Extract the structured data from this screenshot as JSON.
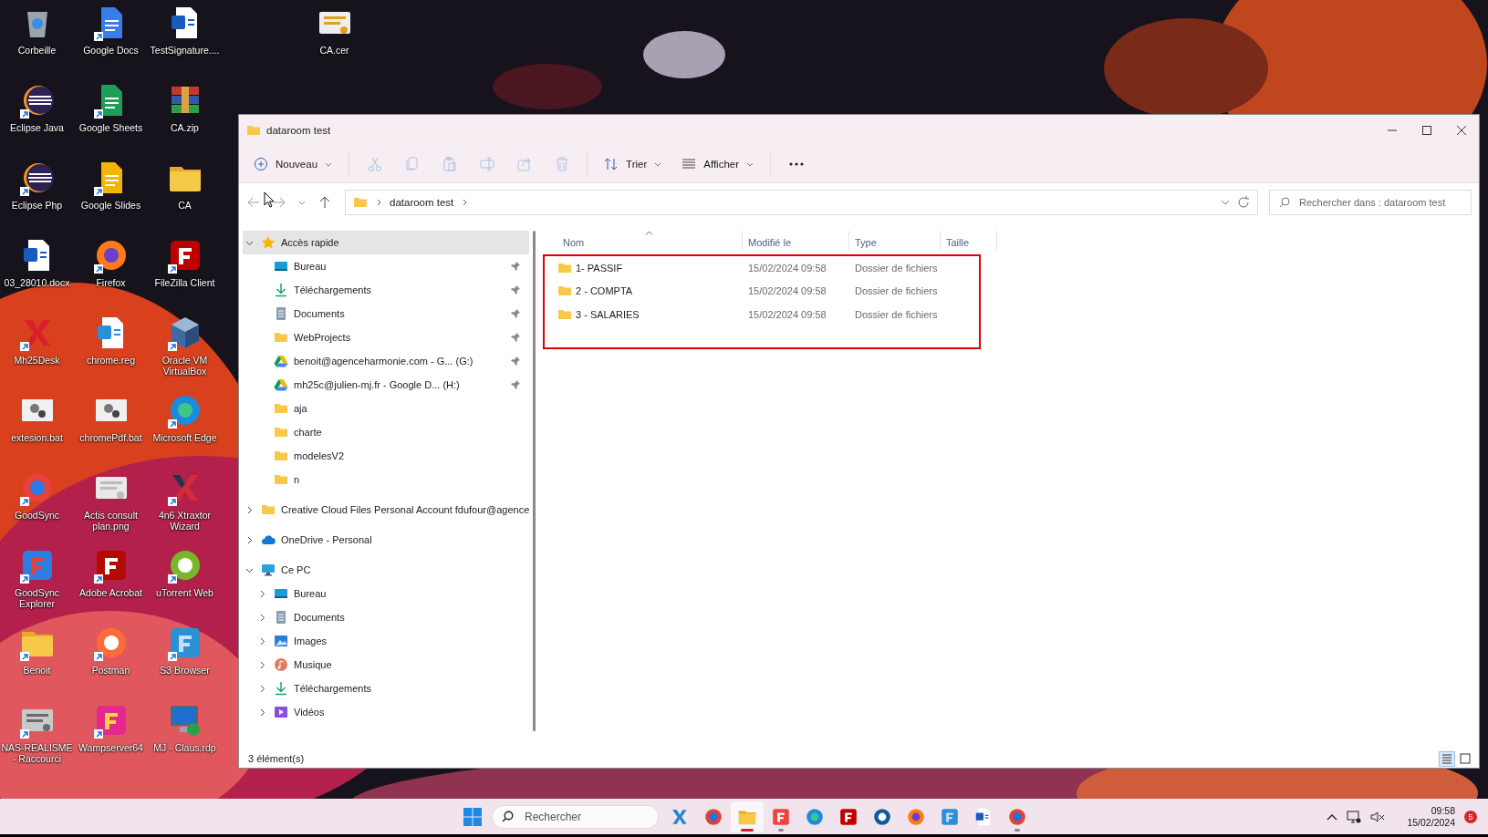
{
  "desktop": {
    "icons": [
      {
        "label": "Corbeille",
        "shortcut": false
      },
      {
        "label": "Google Docs",
        "shortcut": true
      },
      {
        "label": "TestSignature....",
        "shortcut": false
      },
      {
        "label": "Eclipse Java",
        "shortcut": true
      },
      {
        "label": "Google Sheets",
        "shortcut": true
      },
      {
        "label": "CA.zip",
        "shortcut": false
      },
      {
        "label": "Eclipse Php",
        "shortcut": true
      },
      {
        "label": "Google Slides",
        "shortcut": true
      },
      {
        "label": "CA",
        "shortcut": false
      },
      {
        "label": "03_28010.docx",
        "shortcut": false
      },
      {
        "label": "Firefox",
        "shortcut": true
      },
      {
        "label": "FileZilla Client",
        "shortcut": true
      },
      {
        "label": "Mh25Desk",
        "shortcut": true
      },
      {
        "label": "chrome.reg",
        "shortcut": false
      },
      {
        "label": "Oracle VM VirtualBox",
        "shortcut": true
      },
      {
        "label": "extesion.bat",
        "shortcut": false
      },
      {
        "label": "chromePdf.bat",
        "shortcut": false
      },
      {
        "label": "Microsoft Edge",
        "shortcut": true
      },
      {
        "label": "GoodSync",
        "shortcut": true
      },
      {
        "label": "Actis consult plan.png",
        "shortcut": false
      },
      {
        "label": "4n6 Xtraxtor Wizard",
        "shortcut": true
      },
      {
        "label": "GoodSync Explorer",
        "shortcut": true
      },
      {
        "label": "Adobe Acrobat",
        "shortcut": true
      },
      {
        "label": "uTorrent Web",
        "shortcut": true
      },
      {
        "label": "Benoit",
        "shortcut": true
      },
      {
        "label": "Postman",
        "shortcut": true
      },
      {
        "label": "S3 Browser",
        "shortcut": true
      },
      {
        "label": "NAS-REALISME - Raccourci",
        "shortcut": true
      },
      {
        "label": "Wampserver64",
        "shortcut": true
      },
      {
        "label": "MJ - Claus.rdp",
        "shortcut": false
      }
    ],
    "loose_icon": {
      "label": "CA.cer",
      "shortcut": false
    }
  },
  "window": {
    "title": "dataroom test"
  },
  "toolbar": {
    "new_button": {
      "label": "Nouveau"
    },
    "icon_buttons": [
      {
        "disabled": true
      },
      {
        "disabled": true
      },
      {
        "disabled": true
      },
      {
        "disabled": true
      },
      {
        "disabled": true
      },
      {
        "disabled": true
      }
    ],
    "sort_button": {
      "label": "Trier"
    },
    "view_button": {
      "label": "Afficher"
    }
  },
  "address_bar": {
    "path": [
      "dataroom test"
    ]
  },
  "search": {
    "placeholder": "Rechercher dans : dataroom test"
  },
  "navigation": [
    {
      "label": "Accès rapide",
      "kind": "star",
      "expanded": true,
      "selected": true,
      "children": [
        {
          "label": "Bureau",
          "kind": "desktop",
          "pinned": true
        },
        {
          "label": "Téléchargements",
          "kind": "download",
          "pinned": true
        },
        {
          "label": "Documents",
          "kind": "documents",
          "pinned": true
        },
        {
          "label": "WebProjects",
          "kind": "folder",
          "pinned": true
        },
        {
          "label": "benoit@agenceharmonie.com - G... (G:)",
          "kind": "drive",
          "pinned": true
        },
        {
          "label": "mh25c@julien-mj.fr - Google D... (H:)",
          "kind": "drive",
          "pinned": true
        },
        {
          "label": "aja",
          "kind": "folder",
          "pinned": false
        },
        {
          "label": "charte",
          "kind": "folder",
          "pinned": false
        },
        {
          "label": "modelesV2",
          "kind": "folder",
          "pinned": false
        },
        {
          "label": "n",
          "kind": "folder",
          "pinned": false
        }
      ]
    },
    {
      "label": "Creative Cloud Files Personal Account fdufour@agence",
      "kind": "folder",
      "expanded": false,
      "selected": false
    },
    {
      "label": "OneDrive - Personal",
      "kind": "cloud",
      "expanded": false,
      "selected": false
    },
    {
      "label": "Ce PC",
      "kind": "pc",
      "expanded": true,
      "selected": false,
      "children": [
        {
          "label": "Bureau",
          "kind": "desktop",
          "expanded": false
        },
        {
          "label": "Documents",
          "kind": "documents",
          "expanded": false
        },
        {
          "label": "Images",
          "kind": "pictures",
          "expanded": false
        },
        {
          "label": "Musique",
          "kind": "music",
          "expanded": false
        },
        {
          "label": "Téléchargements",
          "kind": "download",
          "expanded": false
        },
        {
          "label": "Vidéos",
          "kind": "videos",
          "expanded": false
        }
      ]
    }
  ],
  "file_list": {
    "columns": [
      {
        "label": "Nom",
        "sorted": true
      },
      {
        "label": "Modifié le",
        "sorted": false
      },
      {
        "label": "Type",
        "sorted": false
      },
      {
        "label": "Taille",
        "sorted": false
      }
    ],
    "rows": [
      {
        "name": "1- PASSIF",
        "modified": "15/02/2024 09:58",
        "type": "Dossier de fichiers"
      },
      {
        "name": "2 - COMPTA",
        "modified": "15/02/2024 09:58",
        "type": "Dossier de fichiers"
      },
      {
        "name": "3 - SALARIES",
        "modified": "15/02/2024 09:58",
        "type": "Dossier de fichiers"
      }
    ]
  },
  "status_bar": {
    "count": "3 élément(s)",
    "view_buttons": [
      {
        "selected": true
      },
      {
        "selected": false
      }
    ]
  },
  "taskbar": {
    "search_placeholder": "Rechercher",
    "apps": [
      {
        "running": false,
        "active": false
      },
      {
        "running": false,
        "active": false
      },
      {
        "running": true,
        "active": true
      },
      {
        "running": true,
        "active": false
      },
      {
        "running": false,
        "active": false
      },
      {
        "running": false,
        "active": false
      },
      {
        "running": false,
        "active": false
      },
      {
        "running": false,
        "active": false
      },
      {
        "running": false,
        "active": false
      },
      {
        "running": false,
        "active": false
      },
      {
        "running": true,
        "active": false
      }
    ],
    "clock": {
      "time": "09:58",
      "date": "15/02/2024"
    },
    "notification_count": "5"
  }
}
